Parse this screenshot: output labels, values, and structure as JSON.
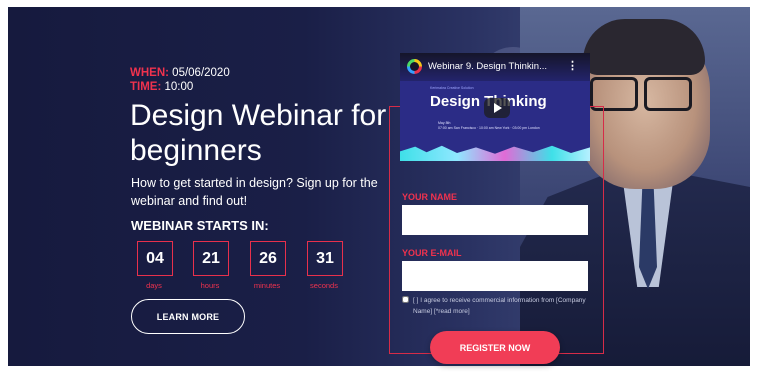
{
  "event": {
    "when_label": "WHEN:",
    "when_value": "05/06/2020",
    "time_label": "TIME:",
    "time_value": "10:00"
  },
  "headline": "Design Webinar for beginners",
  "subtext": "How to get started in design? Sign up for the webinar and find out!",
  "countdown": {
    "title": "WEBINAR STARTS IN:",
    "units": [
      {
        "value": "04",
        "label": "days"
      },
      {
        "value": "21",
        "label": "hours"
      },
      {
        "value": "26",
        "label": "minutes"
      },
      {
        "value": "31",
        "label": "seconds"
      }
    ]
  },
  "learn_more_label": "LEARN MORE",
  "video": {
    "title": "Webinar 9. Design Thinkin...",
    "menu_glyph": "⋮",
    "thumb_heading": "Design Thinking",
    "thumb_small": "Kerimakra Creative Solution",
    "thumb_date": "May 8th",
    "thumb_times": "07:00 am San Francisco · 10:00 am New York · 03:00 pm London"
  },
  "form": {
    "name_label": "YOUR NAME",
    "name_value": "",
    "email_label": "YOUR E-MAIL",
    "email_value": "",
    "agree_text": "[ ] I agree to receive commercial information from [Company Name] [*read more]",
    "submit_label": "REGISTER NOW"
  },
  "colors": {
    "accent": "#f0324e",
    "background": "#1a1f47"
  },
  "icons": [
    "play-icon",
    "video-channel-logo-icon",
    "more-options-icon"
  ]
}
